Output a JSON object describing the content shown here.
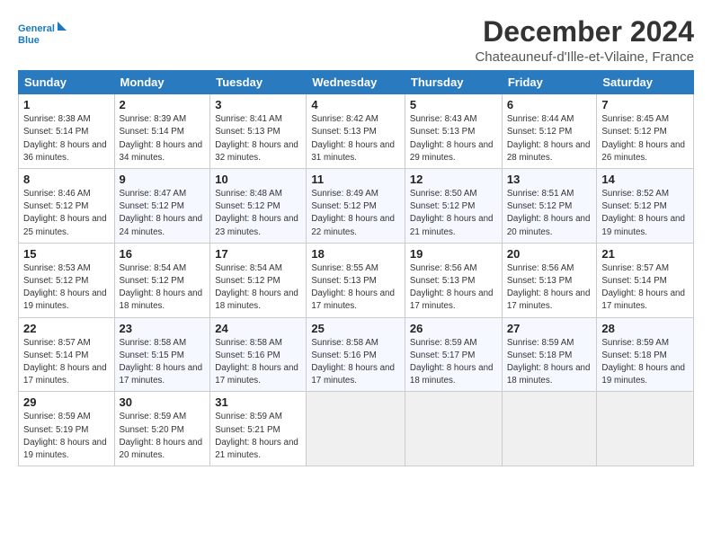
{
  "logo": {
    "line1": "General",
    "line2": "Blue"
  },
  "title": "December 2024",
  "subtitle": "Chateauneuf-d'Ille-et-Vilaine, France",
  "days_of_week": [
    "Sunday",
    "Monday",
    "Tuesday",
    "Wednesday",
    "Thursday",
    "Friday",
    "Saturday"
  ],
  "weeks": [
    [
      {
        "day": "1",
        "sunrise": "Sunrise: 8:38 AM",
        "sunset": "Sunset: 5:14 PM",
        "daylight": "Daylight: 8 hours and 36 minutes."
      },
      {
        "day": "2",
        "sunrise": "Sunrise: 8:39 AM",
        "sunset": "Sunset: 5:14 PM",
        "daylight": "Daylight: 8 hours and 34 minutes."
      },
      {
        "day": "3",
        "sunrise": "Sunrise: 8:41 AM",
        "sunset": "Sunset: 5:13 PM",
        "daylight": "Daylight: 8 hours and 32 minutes."
      },
      {
        "day": "4",
        "sunrise": "Sunrise: 8:42 AM",
        "sunset": "Sunset: 5:13 PM",
        "daylight": "Daylight: 8 hours and 31 minutes."
      },
      {
        "day": "5",
        "sunrise": "Sunrise: 8:43 AM",
        "sunset": "Sunset: 5:13 PM",
        "daylight": "Daylight: 8 hours and 29 minutes."
      },
      {
        "day": "6",
        "sunrise": "Sunrise: 8:44 AM",
        "sunset": "Sunset: 5:12 PM",
        "daylight": "Daylight: 8 hours and 28 minutes."
      },
      {
        "day": "7",
        "sunrise": "Sunrise: 8:45 AM",
        "sunset": "Sunset: 5:12 PM",
        "daylight": "Daylight: 8 hours and 26 minutes."
      }
    ],
    [
      {
        "day": "8",
        "sunrise": "Sunrise: 8:46 AM",
        "sunset": "Sunset: 5:12 PM",
        "daylight": "Daylight: 8 hours and 25 minutes."
      },
      {
        "day": "9",
        "sunrise": "Sunrise: 8:47 AM",
        "sunset": "Sunset: 5:12 PM",
        "daylight": "Daylight: 8 hours and 24 minutes."
      },
      {
        "day": "10",
        "sunrise": "Sunrise: 8:48 AM",
        "sunset": "Sunset: 5:12 PM",
        "daylight": "Daylight: 8 hours and 23 minutes."
      },
      {
        "day": "11",
        "sunrise": "Sunrise: 8:49 AM",
        "sunset": "Sunset: 5:12 PM",
        "daylight": "Daylight: 8 hours and 22 minutes."
      },
      {
        "day": "12",
        "sunrise": "Sunrise: 8:50 AM",
        "sunset": "Sunset: 5:12 PM",
        "daylight": "Daylight: 8 hours and 21 minutes."
      },
      {
        "day": "13",
        "sunrise": "Sunrise: 8:51 AM",
        "sunset": "Sunset: 5:12 PM",
        "daylight": "Daylight: 8 hours and 20 minutes."
      },
      {
        "day": "14",
        "sunrise": "Sunrise: 8:52 AM",
        "sunset": "Sunset: 5:12 PM",
        "daylight": "Daylight: 8 hours and 19 minutes."
      }
    ],
    [
      {
        "day": "15",
        "sunrise": "Sunrise: 8:53 AM",
        "sunset": "Sunset: 5:12 PM",
        "daylight": "Daylight: 8 hours and 19 minutes."
      },
      {
        "day": "16",
        "sunrise": "Sunrise: 8:54 AM",
        "sunset": "Sunset: 5:12 PM",
        "daylight": "Daylight: 8 hours and 18 minutes."
      },
      {
        "day": "17",
        "sunrise": "Sunrise: 8:54 AM",
        "sunset": "Sunset: 5:12 PM",
        "daylight": "Daylight: 8 hours and 18 minutes."
      },
      {
        "day": "18",
        "sunrise": "Sunrise: 8:55 AM",
        "sunset": "Sunset: 5:13 PM",
        "daylight": "Daylight: 8 hours and 17 minutes."
      },
      {
        "day": "19",
        "sunrise": "Sunrise: 8:56 AM",
        "sunset": "Sunset: 5:13 PM",
        "daylight": "Daylight: 8 hours and 17 minutes."
      },
      {
        "day": "20",
        "sunrise": "Sunrise: 8:56 AM",
        "sunset": "Sunset: 5:13 PM",
        "daylight": "Daylight: 8 hours and 17 minutes."
      },
      {
        "day": "21",
        "sunrise": "Sunrise: 8:57 AM",
        "sunset": "Sunset: 5:14 PM",
        "daylight": "Daylight: 8 hours and 17 minutes."
      }
    ],
    [
      {
        "day": "22",
        "sunrise": "Sunrise: 8:57 AM",
        "sunset": "Sunset: 5:14 PM",
        "daylight": "Daylight: 8 hours and 17 minutes."
      },
      {
        "day": "23",
        "sunrise": "Sunrise: 8:58 AM",
        "sunset": "Sunset: 5:15 PM",
        "daylight": "Daylight: 8 hours and 17 minutes."
      },
      {
        "day": "24",
        "sunrise": "Sunrise: 8:58 AM",
        "sunset": "Sunset: 5:16 PM",
        "daylight": "Daylight: 8 hours and 17 minutes."
      },
      {
        "day": "25",
        "sunrise": "Sunrise: 8:58 AM",
        "sunset": "Sunset: 5:16 PM",
        "daylight": "Daylight: 8 hours and 17 minutes."
      },
      {
        "day": "26",
        "sunrise": "Sunrise: 8:59 AM",
        "sunset": "Sunset: 5:17 PM",
        "daylight": "Daylight: 8 hours and 18 minutes."
      },
      {
        "day": "27",
        "sunrise": "Sunrise: 8:59 AM",
        "sunset": "Sunset: 5:18 PM",
        "daylight": "Daylight: 8 hours and 18 minutes."
      },
      {
        "day": "28",
        "sunrise": "Sunrise: 8:59 AM",
        "sunset": "Sunset: 5:18 PM",
        "daylight": "Daylight: 8 hours and 19 minutes."
      }
    ],
    [
      {
        "day": "29",
        "sunrise": "Sunrise: 8:59 AM",
        "sunset": "Sunset: 5:19 PM",
        "daylight": "Daylight: 8 hours and 19 minutes."
      },
      {
        "day": "30",
        "sunrise": "Sunrise: 8:59 AM",
        "sunset": "Sunset: 5:20 PM",
        "daylight": "Daylight: 8 hours and 20 minutes."
      },
      {
        "day": "31",
        "sunrise": "Sunrise: 8:59 AM",
        "sunset": "Sunset: 5:21 PM",
        "daylight": "Daylight: 8 hours and 21 minutes."
      },
      null,
      null,
      null,
      null
    ]
  ]
}
